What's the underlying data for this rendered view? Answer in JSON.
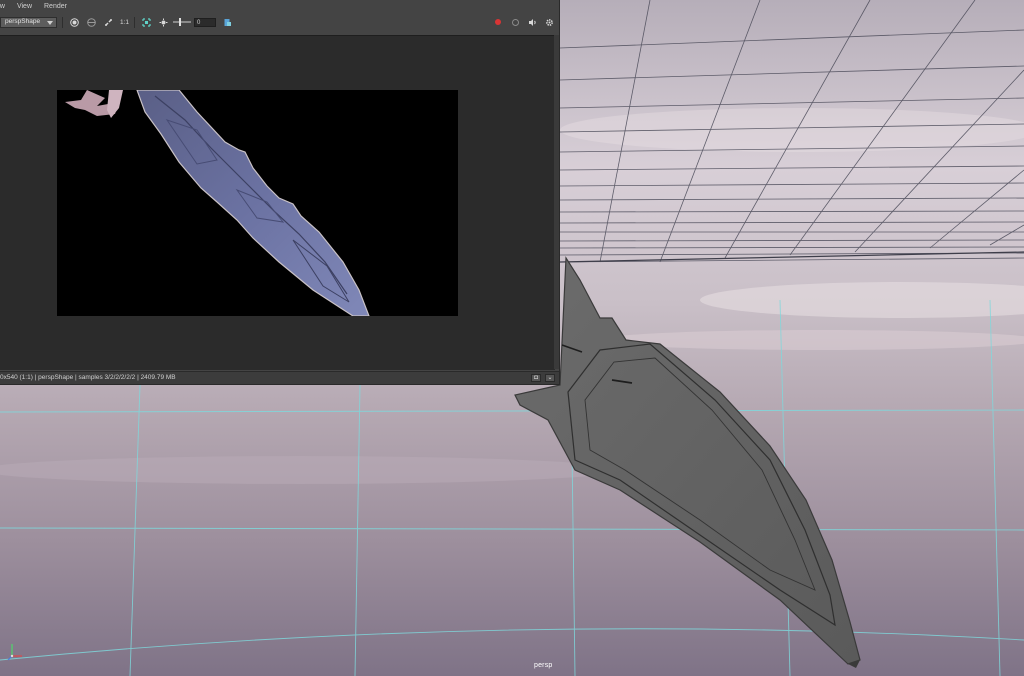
{
  "menu": {
    "items": [
      "ow",
      "View",
      "Render"
    ]
  },
  "toolbar": {
    "camera_select": "perspShape",
    "ratio_label": "1:1",
    "exposure_value": "0"
  },
  "status": {
    "text": "0x540 (1:1) | perspShape  | samples 3/2/2/2/2/2 | 2409.79 MB"
  },
  "viewport": {
    "camera_label": "persp"
  },
  "icons": {
    "snapshot": "snapshot-icon",
    "compare": "compare-icon",
    "refresh": "refresh-icon",
    "region": "region-icon",
    "exposure": "exposure-icon",
    "color": "color-icon",
    "record": "record-icon",
    "sound": "sound-icon",
    "settings": "gear-icon"
  },
  "colors": {
    "panel": "#444444",
    "render_bg": "#2b2b2b",
    "record": "#d93434",
    "grid": "#7fd8dc"
  }
}
